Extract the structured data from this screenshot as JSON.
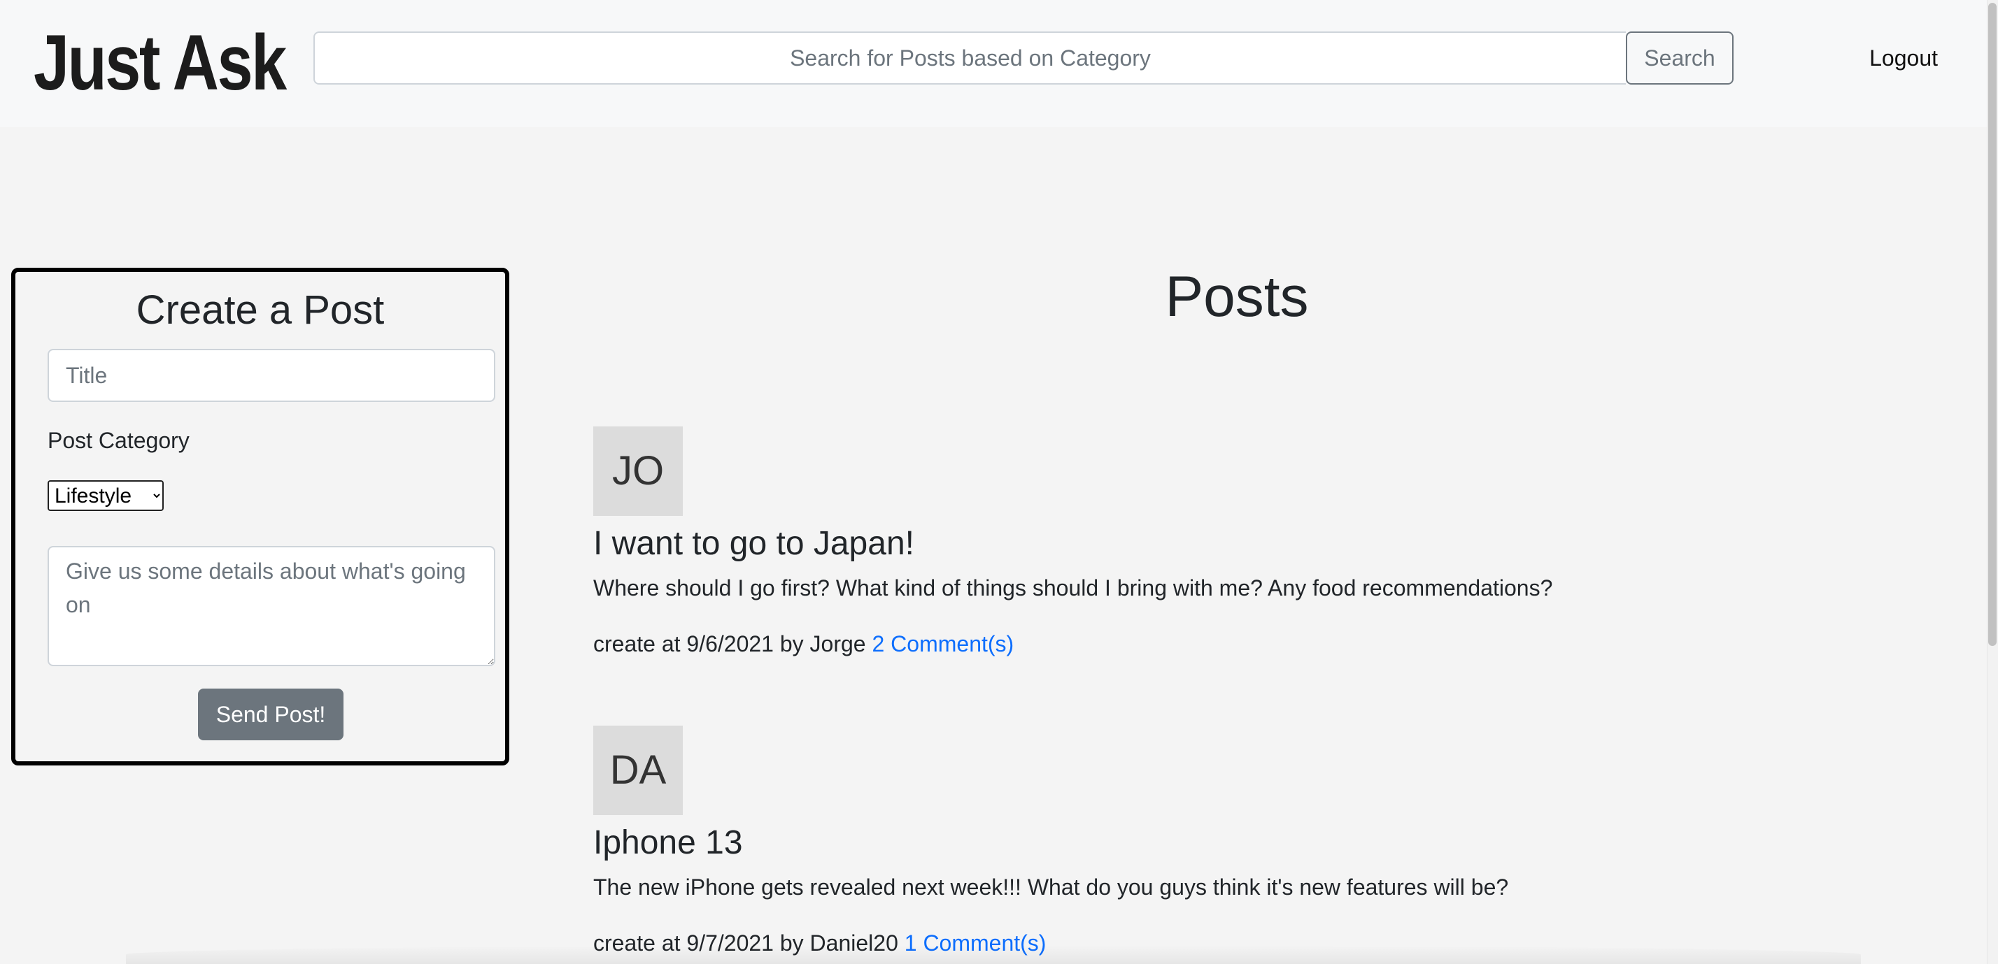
{
  "header": {
    "brand": "Just Ask",
    "search_placeholder": "Search for Posts based on Category",
    "search_button": "Search",
    "logout": "Logout"
  },
  "create_post": {
    "heading": "Create a Post",
    "title_placeholder": "Title",
    "category_label": "Post Category",
    "category_selected": "Lifestyle",
    "details_placeholder": "Give us some details about what's going on",
    "submit_label": "Send Post!"
  },
  "posts_section": {
    "heading": "Posts",
    "posts": [
      {
        "avatar_initials": "JO",
        "title": "I want to go to Japan!",
        "body": "Where should I go first? What kind of things should I bring with me? Any food recommendations?",
        "meta": "create at 9/6/2021 by Jorge",
        "comments": "2 Comment(s)"
      },
      {
        "avatar_initials": "DA",
        "title": "Iphone 13",
        "body": "The new iPhone gets revealed next week!!! What do you guys think it's new features will be?",
        "meta": "create at 9/7/2021 by Daniel20",
        "comments": "1 Comment(s)"
      }
    ]
  },
  "colors": {
    "link": "#0d6efd",
    "button_secondary": "#6c757d",
    "card_border": "#000000",
    "page_background": "#f4f4f4"
  }
}
